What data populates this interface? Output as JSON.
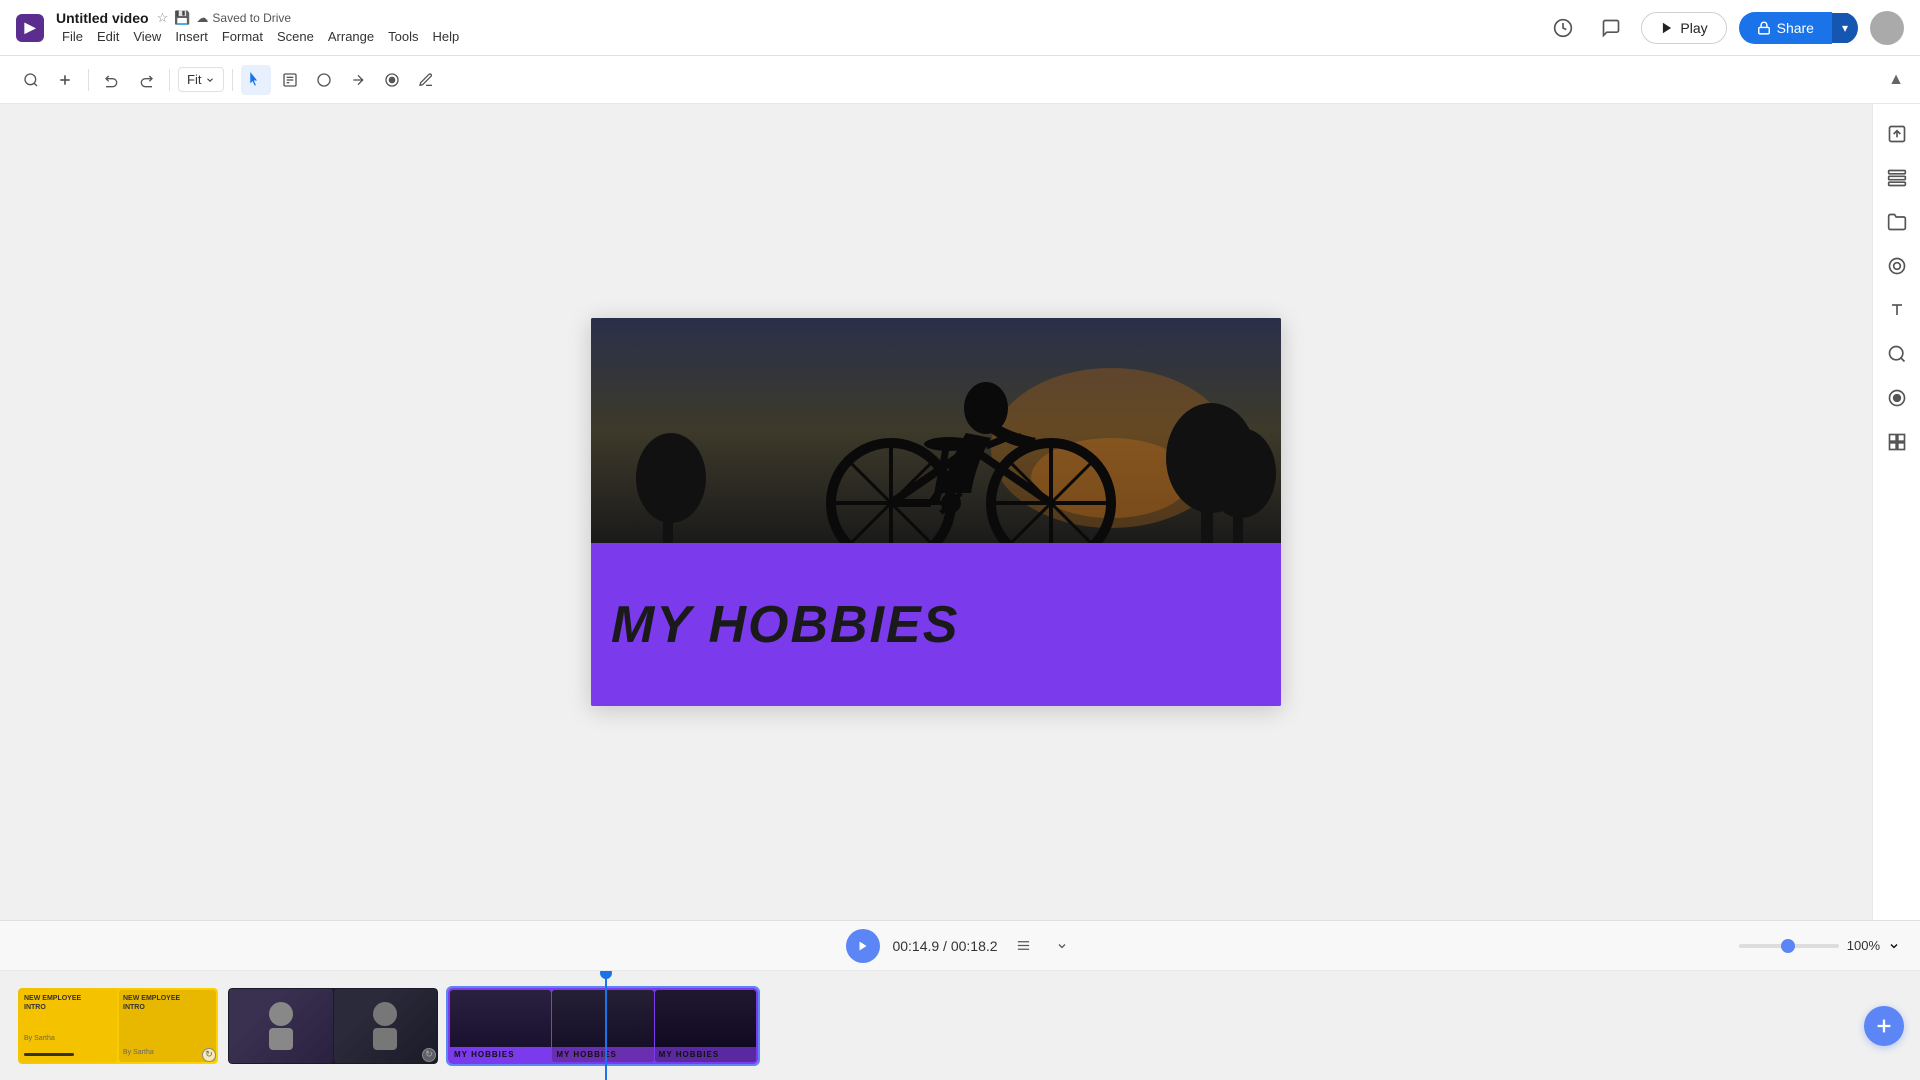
{
  "app": {
    "logo_char": "▶",
    "title": "Untitled video",
    "saved_label": "Saved to Drive"
  },
  "menubar": {
    "items": [
      "File",
      "Edit",
      "View",
      "Insert",
      "Format",
      "Scene",
      "Arrange",
      "Tools",
      "Help"
    ]
  },
  "toolbar": {
    "fit_label": "Fit",
    "collapse_label": "▲"
  },
  "header_actions": {
    "play_label": "Play",
    "share_label": "Share"
  },
  "canvas": {
    "main_text": "MY HOBBIES",
    "title_top_text": ""
  },
  "timeline": {
    "current_time": "00:14.9",
    "total_time": "00:18.2",
    "time_display": "00:14.9 / 00:18.2",
    "zoom_percent": "100%",
    "clips": [
      {
        "id": "clip1",
        "type": "yellow",
        "label": "NEW EMPLOYEE INTRO"
      },
      {
        "id": "clip2",
        "type": "person",
        "label": ""
      },
      {
        "id": "clip3",
        "type": "hobbies",
        "label": "MY HOBBIES",
        "selected": true
      }
    ]
  },
  "right_panel": {
    "icons": [
      {
        "name": "upload-icon",
        "glyph": "⬆"
      },
      {
        "name": "layers-icon",
        "glyph": "▦"
      },
      {
        "name": "folder-icon",
        "glyph": "📁"
      },
      {
        "name": "shapes-icon",
        "glyph": "◎"
      },
      {
        "name": "text-icon",
        "glyph": "T"
      },
      {
        "name": "search-scenes-icon",
        "glyph": "⊙"
      },
      {
        "name": "record-icon",
        "glyph": "◉"
      },
      {
        "name": "template-icon",
        "glyph": "⊞"
      }
    ]
  },
  "icons": {
    "zoom_in": "🔍",
    "plus": "+",
    "undo": "↩",
    "redo": "↪",
    "zoom_out_fit": "⊞",
    "dropdown": "▼",
    "cursor": "↖",
    "text_cursor": "T",
    "circle_tool": "○",
    "select_tool": "↗",
    "fill_tool": "◉",
    "refresh_tool": "↻",
    "history": "🕐",
    "comment": "💬",
    "lock": "🔒",
    "chevron_down": "▾",
    "play_triangle": "▶",
    "settings_timeline": "⊟",
    "chevron_down_small": "▾"
  }
}
